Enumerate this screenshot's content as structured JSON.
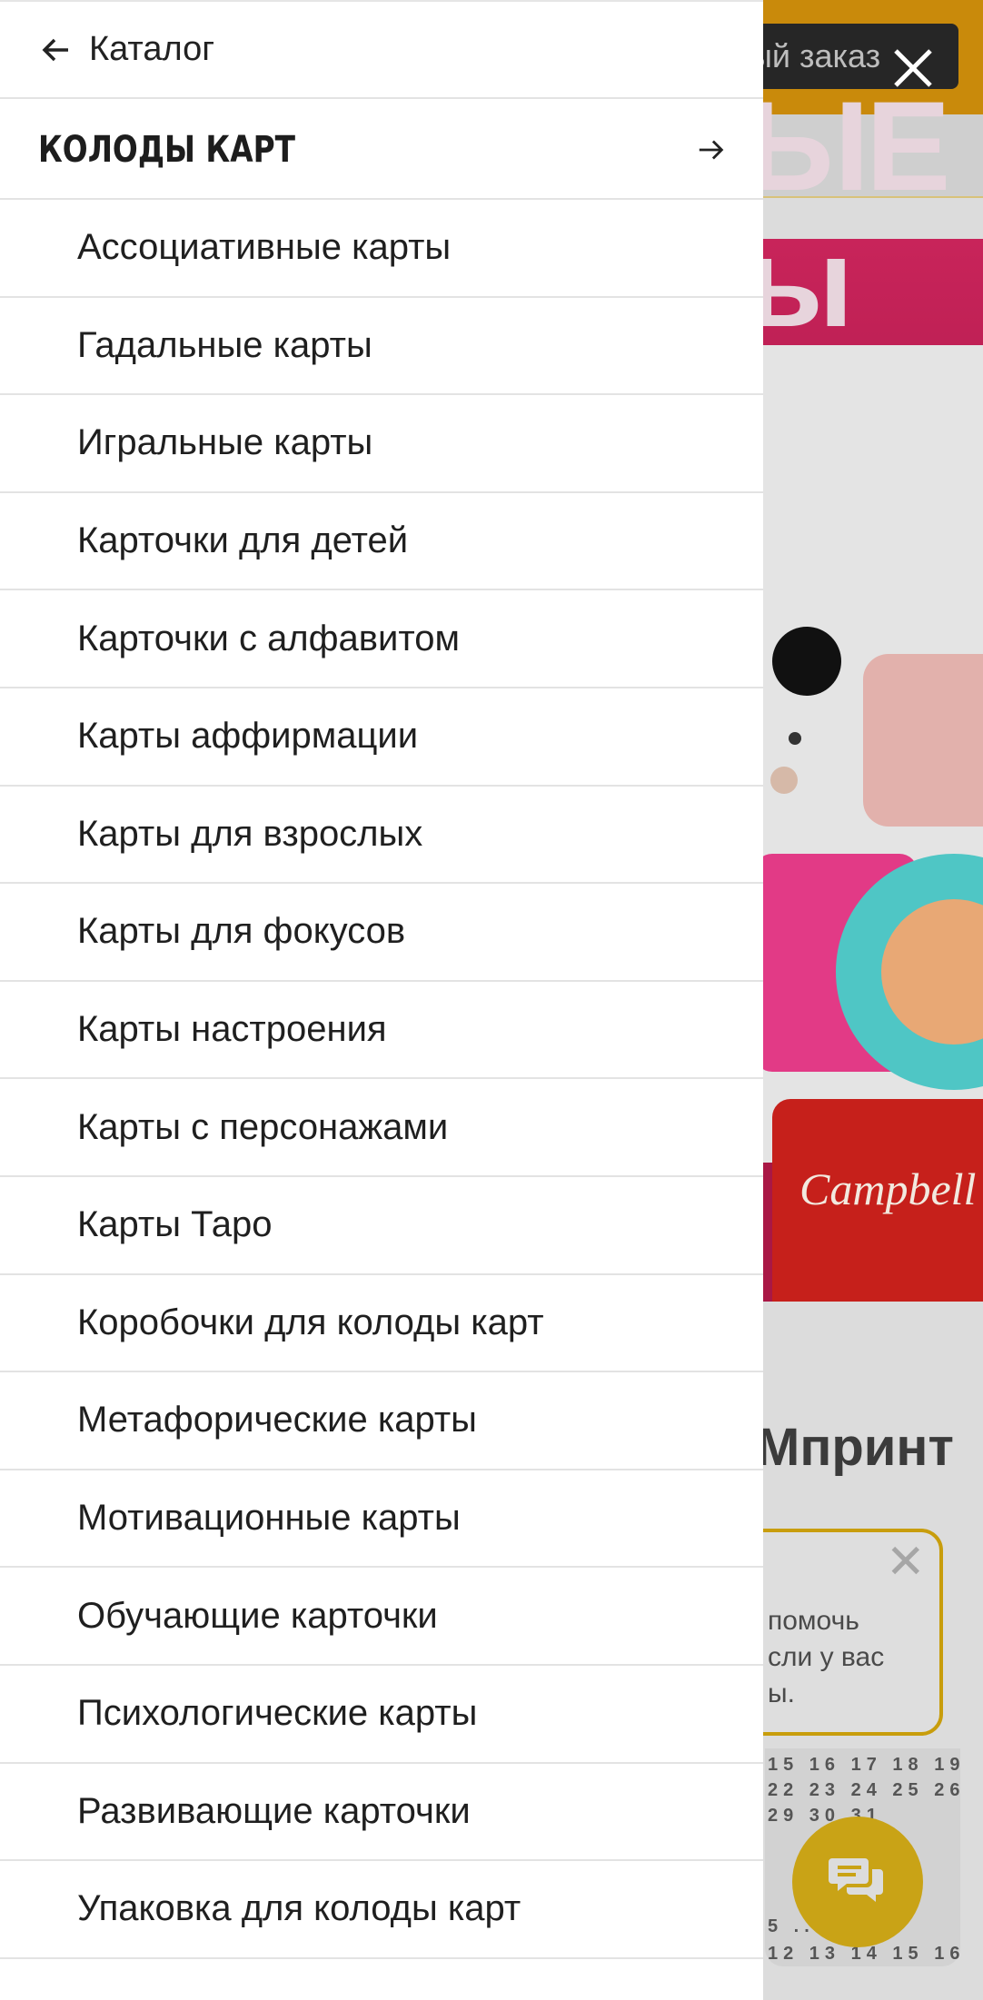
{
  "background": {
    "order_button_label": "ый заказ",
    "banner_text_line1": "ЫЕ",
    "banner_text_line2": "ы",
    "can_brand": "Campbell",
    "section_title": "Мпринт",
    "bubble_text": "помочь\nсли у вас\nы.",
    "calendar_rows": [
      "15 16 17 18 19",
      "22 23 24 25 26",
      "29 30 31",
      "5 ... 2",
      "12 13 14 15 16"
    ],
    "chat_icon": "chat-bubbles-icon",
    "close_icon": "close-icon",
    "colors": {
      "header": "#c98a0b",
      "banner": "#a91745",
      "chat": "#c9a316"
    }
  },
  "drawer": {
    "back_label": "Каталог",
    "back_icon": "arrow-left-icon",
    "section_title": "КОЛОДЫ КАРТ",
    "section_icon": "arrow-right-icon",
    "items": [
      "Ассоциативные карты",
      "Гадальные карты",
      "Игральные карты",
      "Карточки для детей",
      "Карточки с алфавитом",
      "Карты аффирмации",
      "Карты для взрослых",
      "Карты для фокусов",
      "Карты настроения",
      "Карты с персонажами",
      "Карты Таро",
      "Коробочки для колоды карт",
      "Метафорические карты",
      "Мотивационные карты",
      "Обучающие карточки",
      "Психологические карты",
      "Развивающие карточки",
      "Упаковка для колоды карт"
    ]
  }
}
